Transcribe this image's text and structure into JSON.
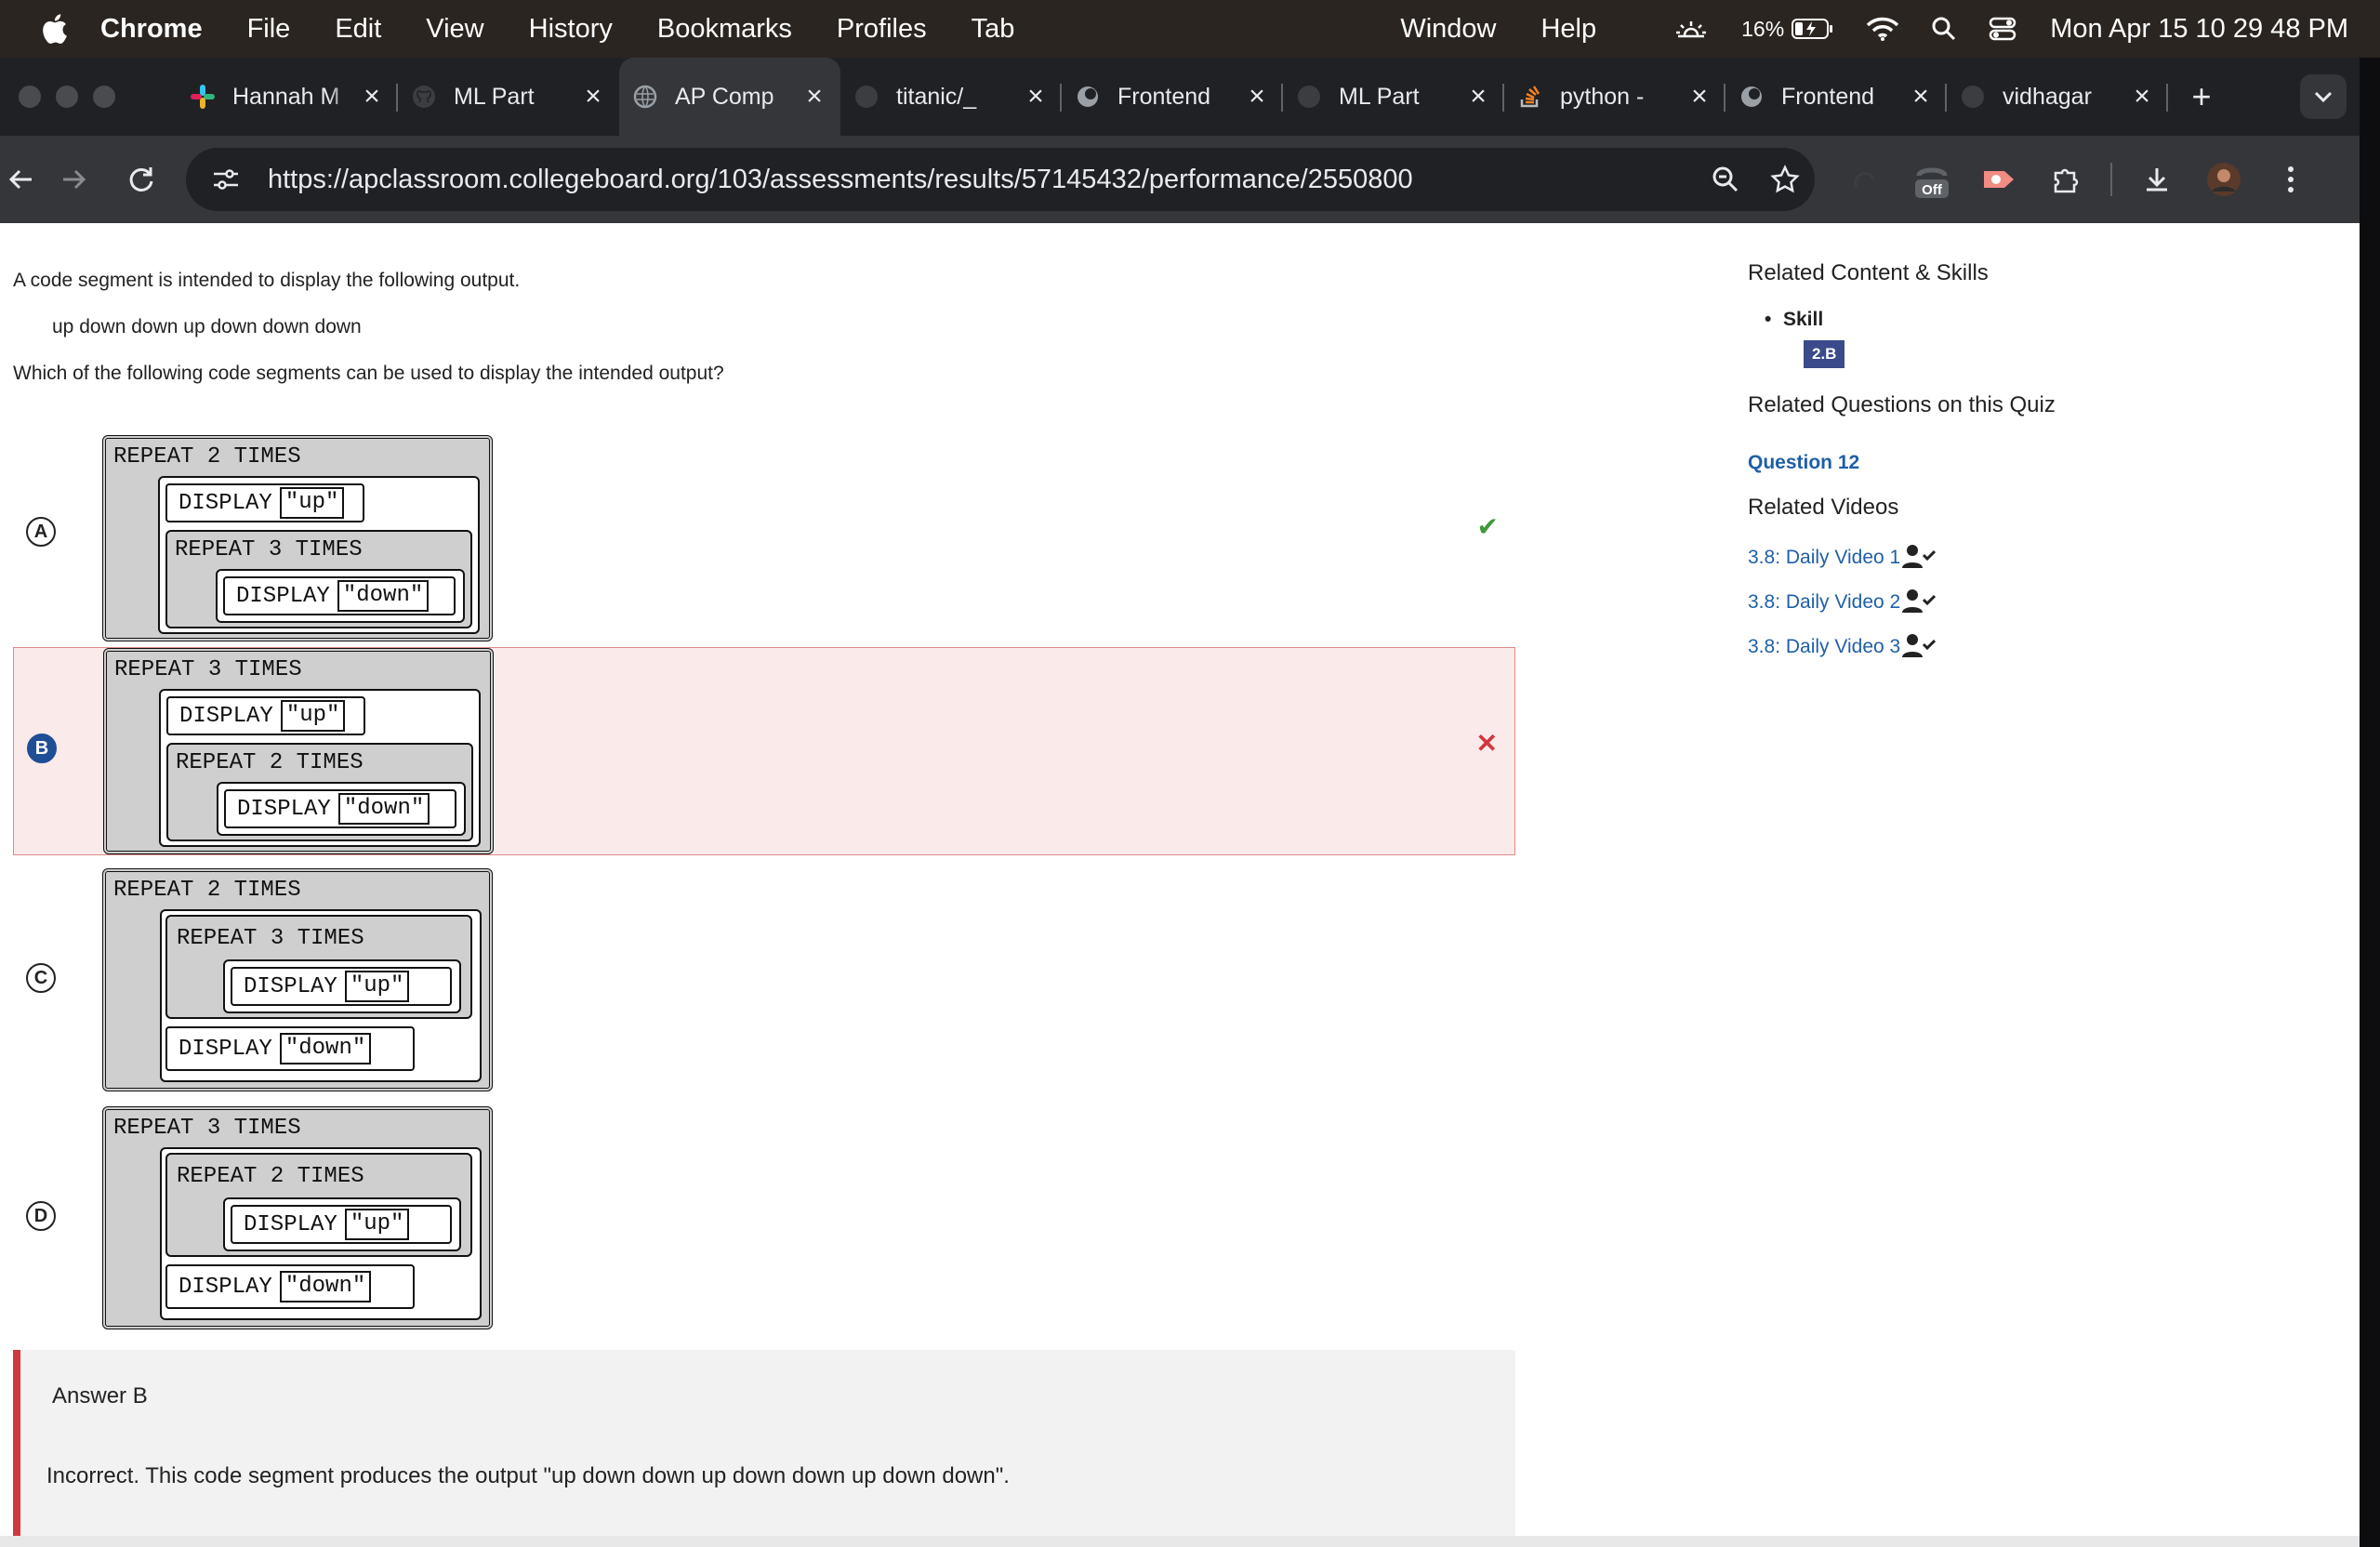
{
  "menubar": {
    "app": "Chrome",
    "items": [
      "File",
      "Edit",
      "View",
      "History",
      "Bookmarks",
      "Profiles",
      "Tab"
    ],
    "right_items": [
      "Window",
      "Help"
    ],
    "battery": "16%",
    "clock": "Mon Apr 15  10 29 48 PM"
  },
  "tabs": [
    {
      "title": "Hannah M",
      "icon": "slack-icon"
    },
    {
      "title": "ML Part",
      "icon": "github-icon"
    },
    {
      "title": "AP Comp",
      "icon": "globe-icon",
      "active": true
    },
    {
      "title": "titanic/_",
      "icon": "github-icon"
    },
    {
      "title": "Frontend",
      "icon": "globe-icon"
    },
    {
      "title": "ML Part",
      "icon": "github-icon"
    },
    {
      "title": "python -",
      "icon": "stackoverflow-icon"
    },
    {
      "title": "Frontend",
      "icon": "globe-icon"
    },
    {
      "title": "vidhagar",
      "icon": "github-icon"
    }
  ],
  "toolbar": {
    "url": "https://apclassroom.collegeboard.org/103/assessments/results/57145432/performance/2550800",
    "ext_badge": "Off"
  },
  "question": {
    "intro": "A code segment is intended to display the following output.",
    "output": "up down down up down down down",
    "prompt": "Which of the following code segments can be used to display the intended output?"
  },
  "options": [
    {
      "letter": "A",
      "status": "correct",
      "outer": "REPEAT 2 TIMES",
      "first": "DISPLAY",
      "first_str": "\"up\"",
      "inner": "REPEAT 3 TIMES",
      "inner_disp": "DISPLAY",
      "inner_str": "\"down\""
    },
    {
      "letter": "B",
      "status": "selected-wrong",
      "outer": "REPEAT 3 TIMES",
      "first": "DISPLAY",
      "first_str": "\"up\"",
      "inner": "REPEAT 2 TIMES",
      "inner_disp": "DISPLAY",
      "inner_str": "\"down\""
    },
    {
      "letter": "C",
      "status": "none",
      "outer": "REPEAT 2 TIMES",
      "inner": "REPEAT 3 TIMES",
      "inner_disp": "DISPLAY",
      "inner_str": "\"up\"",
      "last": "DISPLAY",
      "last_str": "\"down\""
    },
    {
      "letter": "D",
      "status": "none",
      "outer": "REPEAT 3 TIMES",
      "inner": "REPEAT 2 TIMES",
      "inner_disp": "DISPLAY",
      "inner_str": "\"up\"",
      "last": "DISPLAY",
      "last_str": "\"down\""
    }
  ],
  "feedback": {
    "answer": "Answer B",
    "explanation": "Incorrect. This code segment produces the output \"up down down up down down up down down\"."
  },
  "sidebar": {
    "related_heading": "Related Content & Skills",
    "skill_label": "Skill",
    "skill_badge": "2.B",
    "questions_heading": "Related Questions on this Quiz",
    "question_link": "Question 12",
    "videos_heading": "Related Videos",
    "videos": [
      "3.8: Daily Video 1",
      "3.8: Daily Video 2",
      "3.8: Daily Video 3"
    ]
  },
  "colors": {
    "correct": "#3f9a3a",
    "incorrect": "#d0383f",
    "link": "#1f5fa8",
    "selected": "#1f4e96"
  }
}
